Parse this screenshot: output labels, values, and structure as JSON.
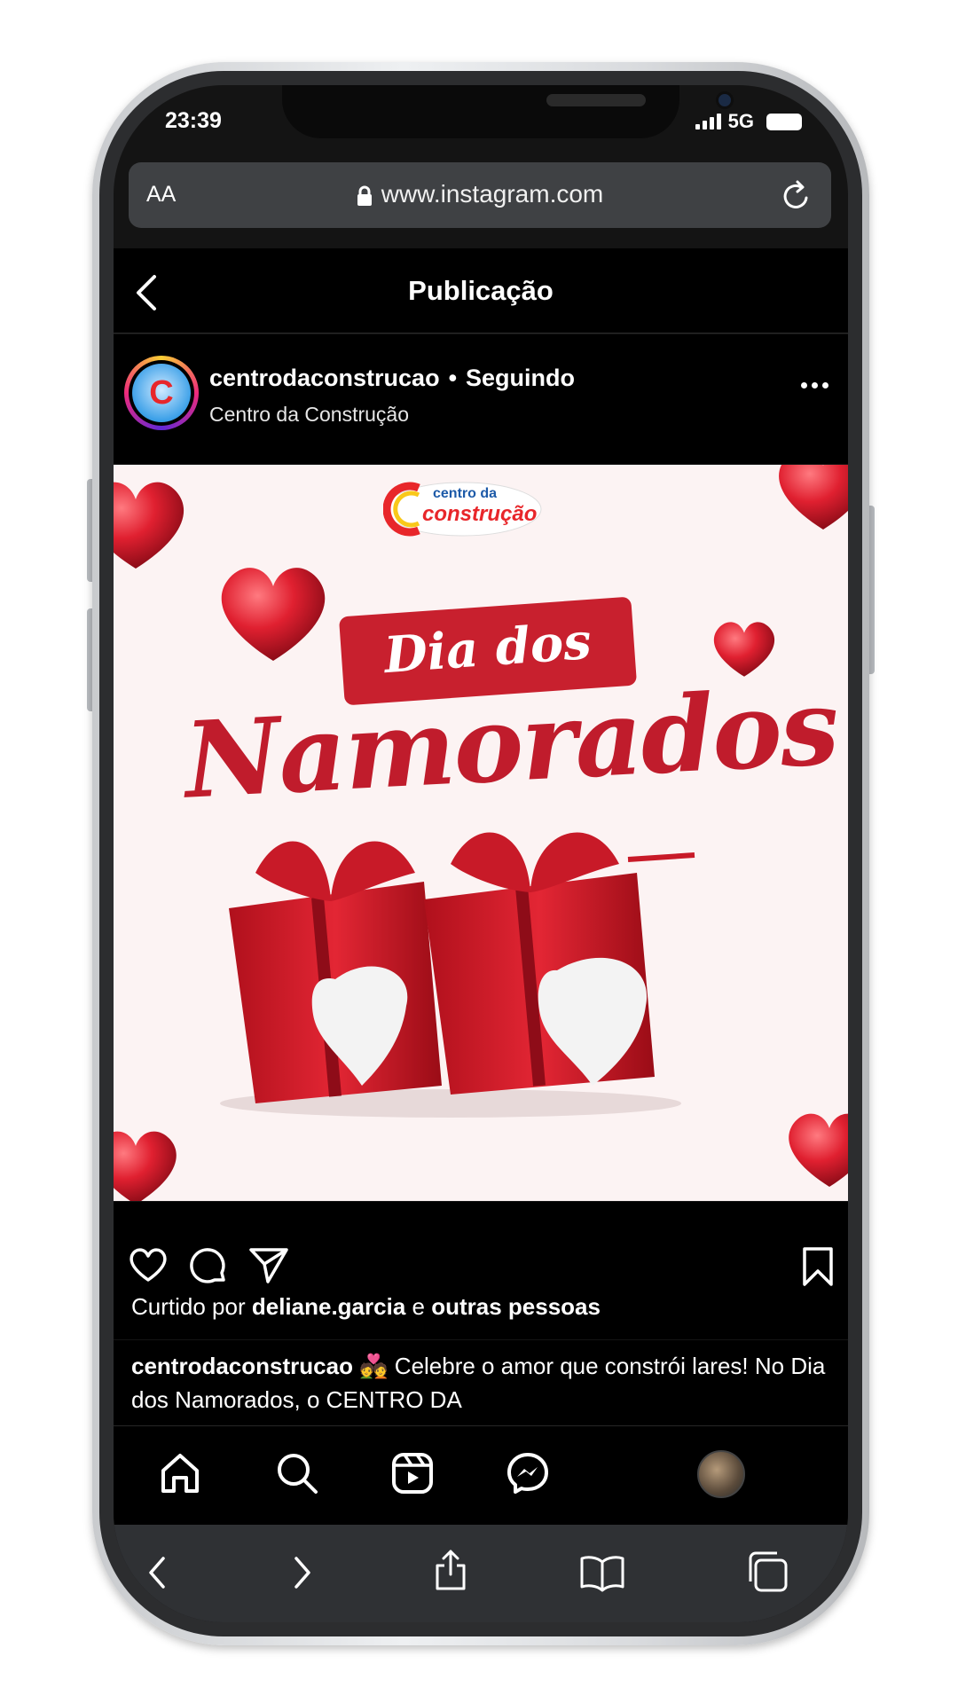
{
  "status_bar": {
    "time": "23:39",
    "network": "5G"
  },
  "browser": {
    "aa_label": "AA",
    "url": "www.instagram.com"
  },
  "instagram": {
    "page_title": "Publicação",
    "post": {
      "username": "centrodaconstrucao",
      "follow_state": "Seguindo",
      "separator": "•",
      "display_name": "Centro da Construção",
      "image": {
        "logo_text_top": "centro da",
        "logo_text_bottom": "construção",
        "headline_line1": "Dia dos",
        "headline_line2": "Namorados"
      },
      "likes": {
        "prefix": "Curtido por",
        "user": "deliane.garcia",
        "connector": "e",
        "others": "outras pessoas"
      },
      "caption": {
        "username": "centrodaconstrucao",
        "emoji": "💑",
        "text": " Celebre o amor que constrói lares! No Dia dos Namorados, o CENTRO DA"
      }
    },
    "nav": [
      "home-icon",
      "search-icon",
      "reels-icon",
      "messenger-icon",
      "profile-avatar"
    ]
  },
  "icons": [
    "back-icon",
    "lock-icon",
    "reload-icon",
    "heart-icon",
    "comment-icon",
    "share-icon",
    "bookmark-icon",
    "more-icon"
  ],
  "colors": {
    "accent_red": "#c8202e",
    "background": "#000000",
    "image_bg": "#fcf3f3"
  }
}
